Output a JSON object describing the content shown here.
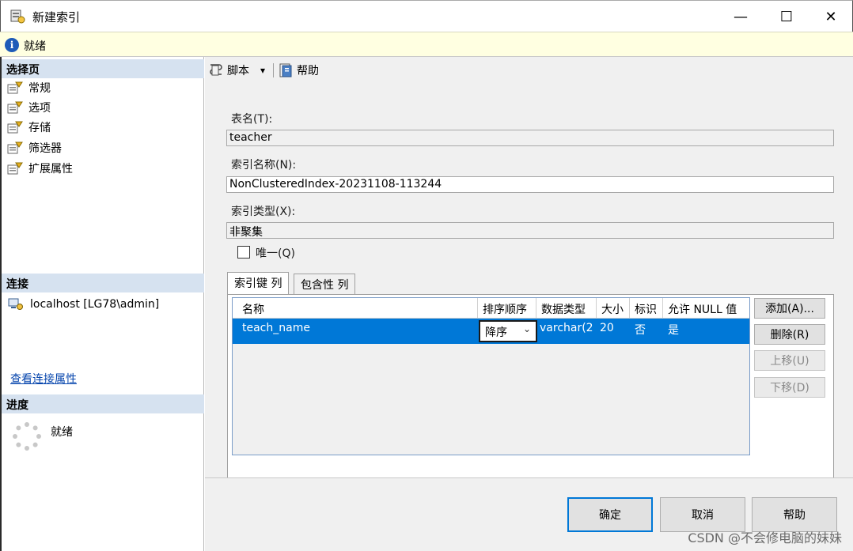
{
  "window": {
    "title": "新建索引",
    "minimize": "—",
    "maximize": "☐",
    "close": "✕"
  },
  "status": {
    "text": "就绪"
  },
  "left": {
    "select_page_header": "选择页",
    "pages": [
      {
        "label": "常规"
      },
      {
        "label": "选项"
      },
      {
        "label": "存储"
      },
      {
        "label": "筛选器"
      },
      {
        "label": "扩展属性"
      }
    ],
    "connection_header": "连接",
    "connection_server": "localhost [LG78\\admin]",
    "view_connection_link": "查看连接属性",
    "progress_header": "进度",
    "progress_status": "就绪"
  },
  "toolbar": {
    "script_label": "脚本",
    "script_dropdown": "▾",
    "help_label": "帮助"
  },
  "form": {
    "table_name_label": "表名(T):",
    "table_name_value": "teacher",
    "index_name_label": "索引名称(N):",
    "index_name_value": "NonClusteredIndex-20231108-113244",
    "index_type_label": "索引类型(X):",
    "index_type_value": "非聚集",
    "unique_label": "唯一(Q)"
  },
  "tabs": [
    {
      "label": "索引键 列"
    },
    {
      "label": "包含性 列"
    }
  ],
  "grid": {
    "columns": [
      "名称",
      "排序顺序",
      "数据类型",
      "大小",
      "标识",
      "允许 NULL 值"
    ],
    "rows": [
      {
        "name": "teach_name",
        "sort": "降序",
        "type": "varchar(2",
        "size": "20",
        "identity": "否",
        "nullable": "是"
      }
    ],
    "select_arrow": "⌄"
  },
  "side_buttons": {
    "add": "添加(A)...",
    "remove": "删除(R)",
    "move_up": "上移(U)",
    "move_down": "下移(D)"
  },
  "footer": {
    "ok": "确定",
    "cancel": "取消",
    "help": "帮助"
  },
  "watermark": "CSDN @不会修电脑的妹妹",
  "colors": {
    "selection": "#0078d7",
    "section_header": "#d6e2f0",
    "status_bg": "#ffffe1"
  }
}
